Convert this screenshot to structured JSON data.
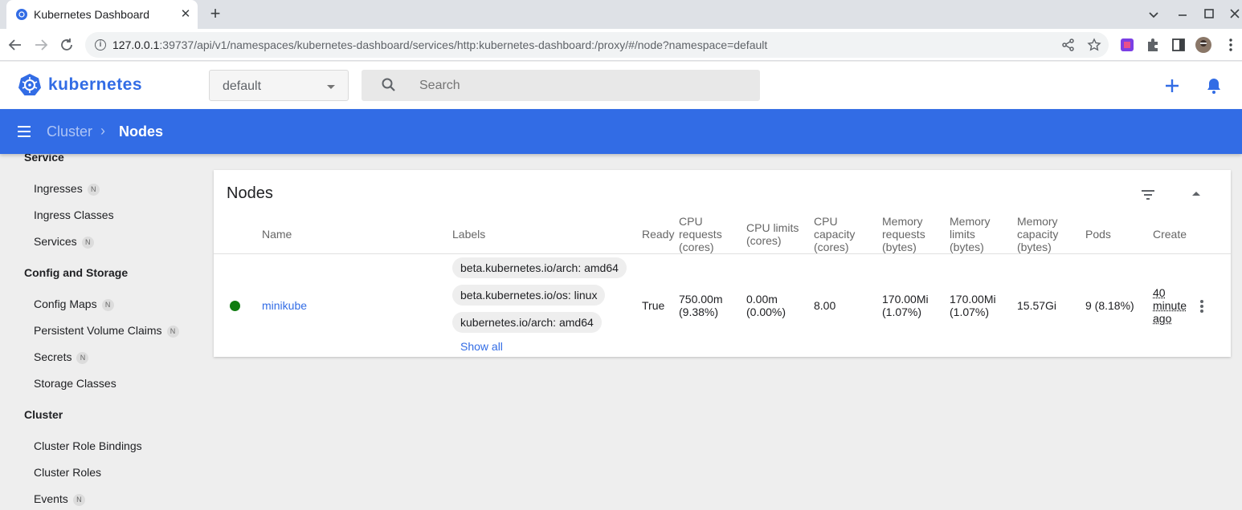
{
  "browser": {
    "tab_title": "Kubernetes Dashboard",
    "tab_close": "✕",
    "new_tab": "+",
    "url_host": "127.0.0.1",
    "url_rest": ":39737/api/v1/namespaces/kubernetes-dashboard/services/http:kubernetes-dashboard:/proxy/#/node?namespace=default"
  },
  "header": {
    "logo_text": "kubernetes",
    "namespace": "default",
    "search_placeholder": "Search"
  },
  "breadcrumb": {
    "parent": "Cluster",
    "separator": "›",
    "current": "Nodes"
  },
  "sidebar": {
    "sections": [
      {
        "title": "Service",
        "items": [
          {
            "label": "Ingresses",
            "badge": "N"
          },
          {
            "label": "Ingress Classes",
            "badge": ""
          },
          {
            "label": "Services",
            "badge": "N"
          }
        ]
      },
      {
        "title": "Config and Storage",
        "items": [
          {
            "label": "Config Maps",
            "badge": "N"
          },
          {
            "label": "Persistent Volume Claims",
            "badge": "N"
          },
          {
            "label": "Secrets",
            "badge": "N"
          },
          {
            "label": "Storage Classes",
            "badge": ""
          }
        ]
      },
      {
        "title": "Cluster",
        "items": [
          {
            "label": "Cluster Role Bindings",
            "badge": ""
          },
          {
            "label": "Cluster Roles",
            "badge": ""
          },
          {
            "label": "Events",
            "badge": "N"
          }
        ]
      }
    ]
  },
  "nodes_card": {
    "title": "Nodes",
    "columns": {
      "name": "Name",
      "labels": "Labels",
      "ready": "Ready",
      "cpu_requests": [
        "CPU",
        "requests",
        "(cores)"
      ],
      "cpu_limits": [
        "CPU limits",
        "(cores)"
      ],
      "cpu_capacity": [
        "CPU",
        "capacity",
        "(cores)"
      ],
      "mem_requests": [
        "Memory",
        "requests",
        "(bytes)"
      ],
      "mem_limits": [
        "Memory",
        "limits",
        "(bytes)"
      ],
      "mem_capacity": [
        "Memory",
        "capacity",
        "(bytes)"
      ],
      "pods": "Pods",
      "created": "Create"
    },
    "rows": [
      {
        "name": "minikube",
        "labels": [
          "beta.kubernetes.io/arch: amd64",
          "beta.kubernetes.io/os: linux",
          "kubernetes.io/arch: amd64"
        ],
        "show_all": "Show all",
        "ready": "True",
        "cpu_requests": [
          "750.00m",
          "(9.38%)"
        ],
        "cpu_limits": [
          "0.00m",
          "(0.00%)"
        ],
        "cpu_capacity": "8.00",
        "mem_requests": [
          "170.00Mi",
          "(1.07%)"
        ],
        "mem_limits": [
          "170.00Mi",
          "(1.07%)"
        ],
        "mem_capacity": "15.57Gi",
        "pods": "9 (8.18%)",
        "created": [
          "40",
          "minute",
          "ago"
        ]
      }
    ]
  },
  "colors": {
    "brand_blue": "#326ce5",
    "status_ready": "#0f7c10"
  }
}
